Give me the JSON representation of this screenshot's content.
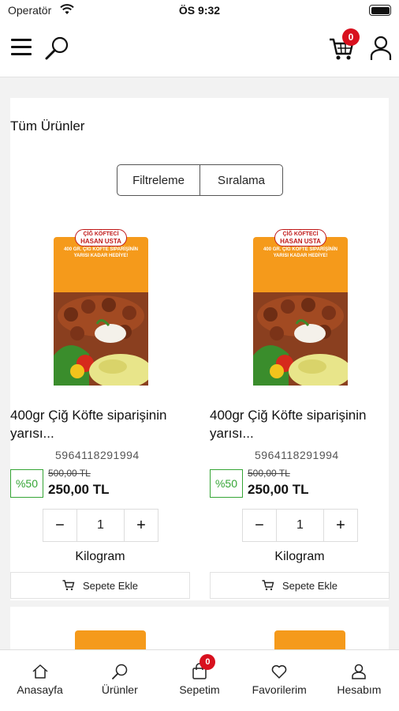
{
  "status_bar": {
    "carrier": "Operatör",
    "time": "ÖS 9:32"
  },
  "header": {
    "cart_count": "0"
  },
  "page": {
    "title": "Tüm Ürünler",
    "filter_label": "Filtreleme",
    "sort_label": "Sıralama"
  },
  "products": [
    {
      "name": "400gr Çiğ Köfte siparişinin yarısı...",
      "code": "5964118291994",
      "discount": "%50",
      "old_price": "500,00 TL",
      "new_price": "250,00 TL",
      "quantity": "1",
      "unit": "Kilogram",
      "add_to_cart": "Sepete Ekle",
      "image": {
        "brand_top": "ÇİĞ KÖFTECİ",
        "brand": "HASAN USTA",
        "promo": "400 GR. ÇİĞ KÖFTE SİPARİŞİNİN YARISI KADAR HEDİYE!"
      }
    },
    {
      "name": "400gr Çiğ Köfte siparişinin yarısı...",
      "code": "5964118291994",
      "discount": "%50",
      "old_price": "500,00 TL",
      "new_price": "250,00 TL",
      "quantity": "1",
      "unit": "Kilogram",
      "add_to_cart": "Sepete Ekle",
      "image": {
        "brand_top": "ÇİĞ KÖFTECİ",
        "brand": "HASAN USTA",
        "promo": "400 GR. ÇİĞ KÖFTE SİPARİŞİNİN YARISI KADAR HEDİYE!"
      }
    }
  ],
  "bottom_nav": {
    "items": [
      {
        "label": "Anasayfa",
        "icon": "home-icon"
      },
      {
        "label": "Ürünler",
        "icon": "search-icon"
      },
      {
        "label": "Sepetim",
        "icon": "bag-icon",
        "badge": "0"
      },
      {
        "label": "Favorilerim",
        "icon": "heart-icon"
      },
      {
        "label": "Hesabım",
        "icon": "user-icon"
      }
    ]
  },
  "colors": {
    "badge_red": "#d8101e",
    "discount_green": "#35a535",
    "promo_orange": "#f59a1b"
  }
}
